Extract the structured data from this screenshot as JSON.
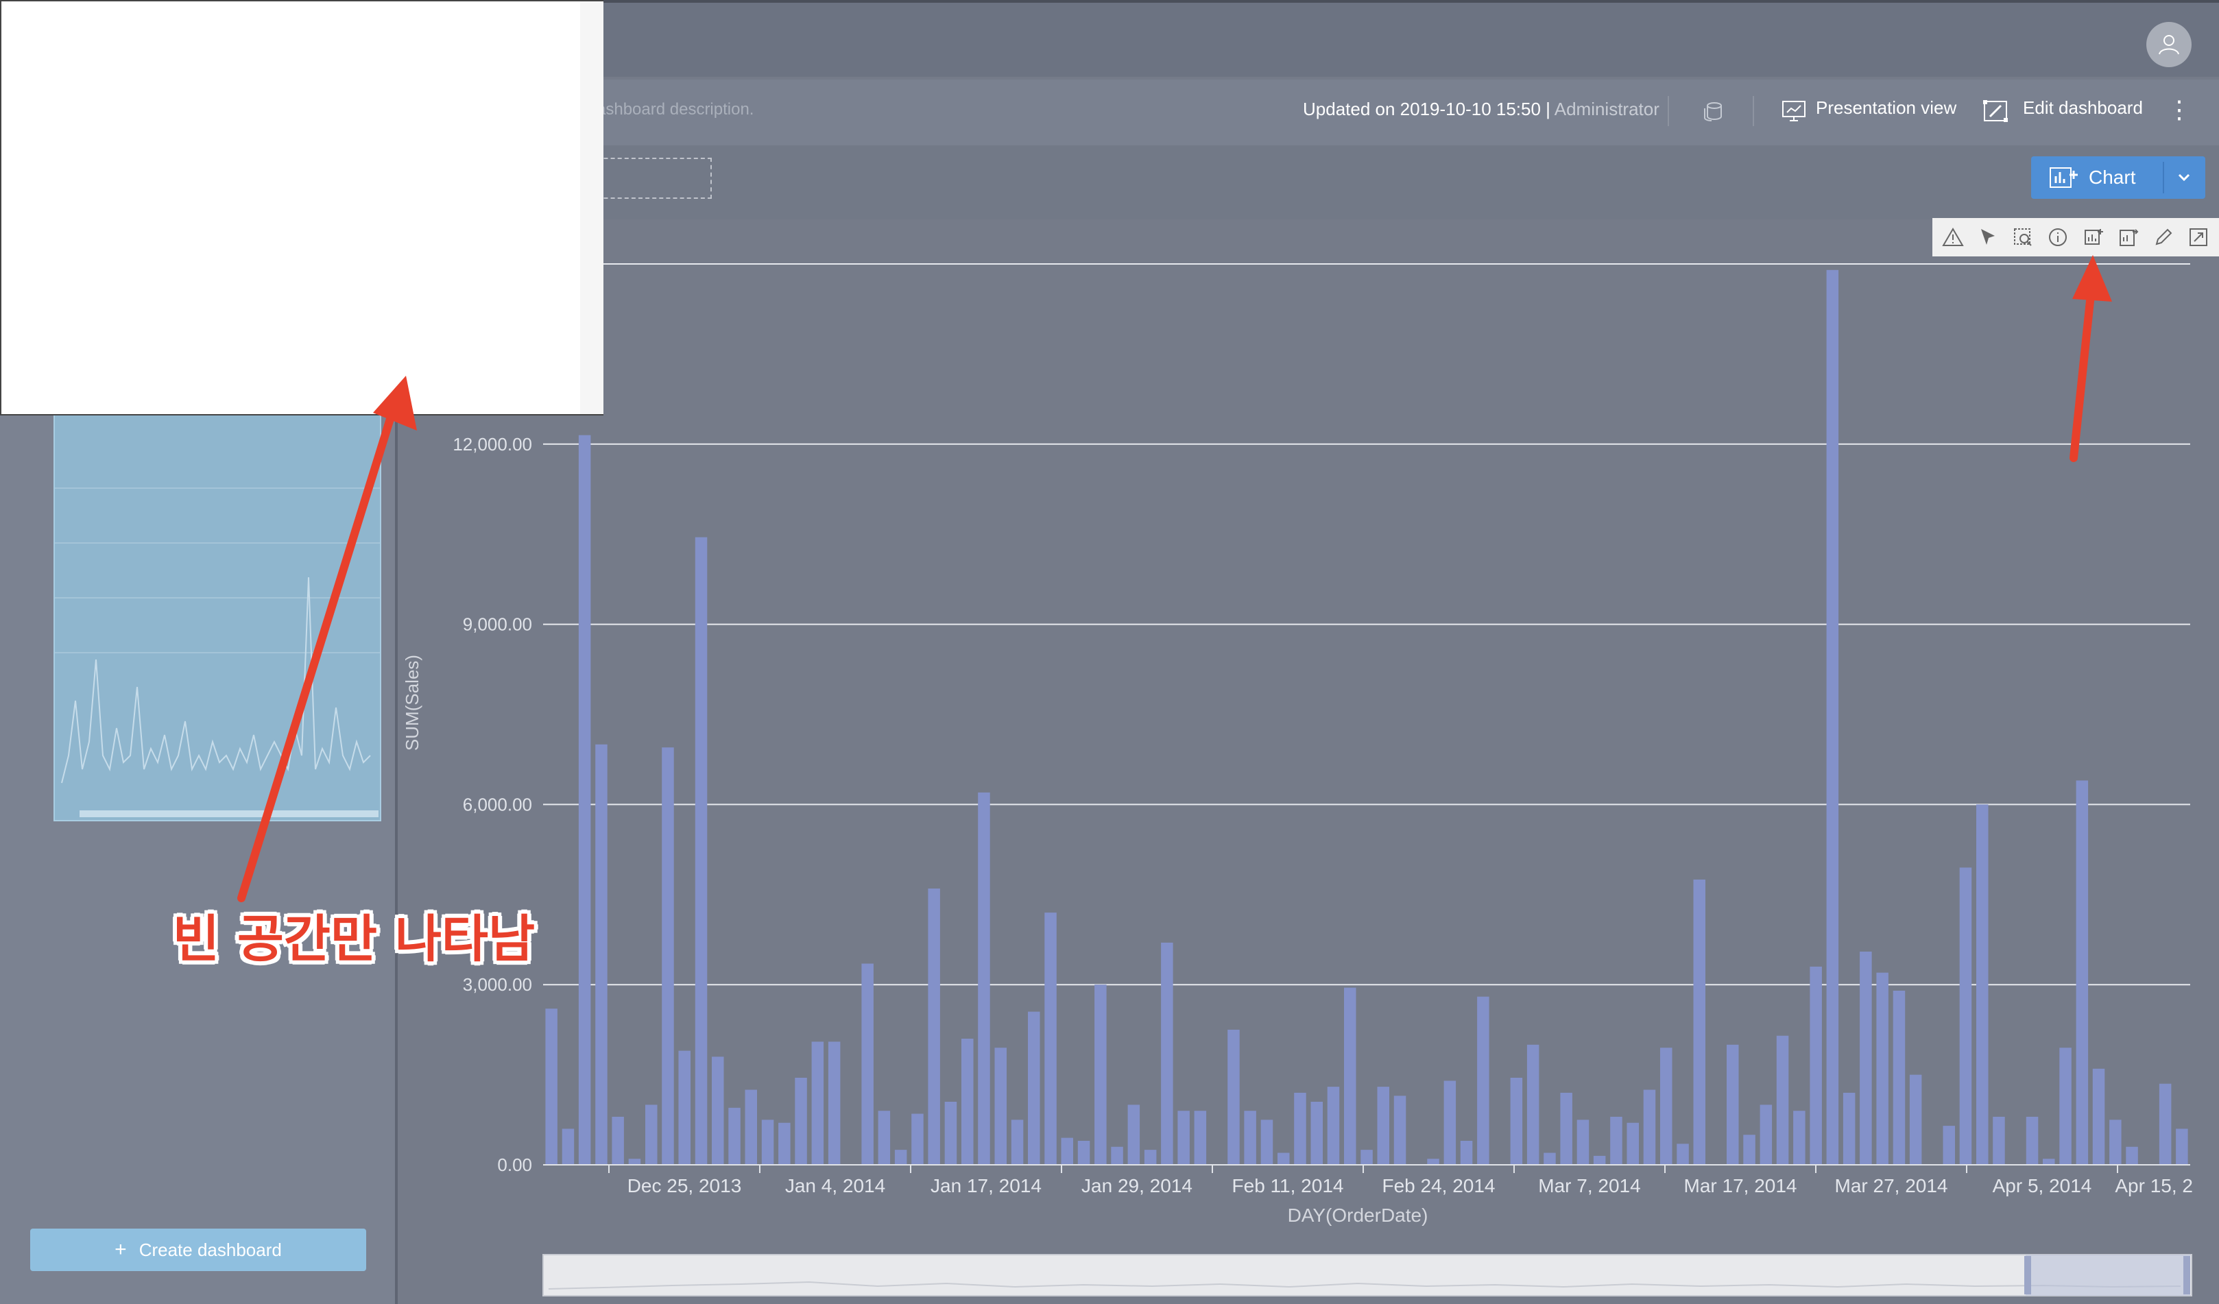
{
  "header": {
    "description_fragment": "ashboard description.",
    "updated": "Updated on 2019-10-10 15:50",
    "separator": " | ",
    "updated_by": "Administrator",
    "presentation_label": "Presentation view",
    "edit_label": "Edit dashboard",
    "more_label": "⋮"
  },
  "toolbar": {
    "chart_button_label": "Chart"
  },
  "sidebar": {
    "create_button_label": "Create dashboard",
    "create_button_glyph": "+"
  },
  "annotation": {
    "text": "빈 공간만 나타남"
  },
  "colors": {
    "bar": "#8391c9",
    "accent_blue": "#4f8fd6",
    "annotation": "#e8402b",
    "background": "#757b89"
  },
  "icons": {
    "chart_toolbar": [
      "warning-icon",
      "pointer-icon",
      "zoom-select-icon",
      "info-icon",
      "add-chart-icon",
      "export-icon",
      "edit-icon",
      "fullscreen-icon"
    ]
  },
  "chart_data": {
    "type": "bar",
    "xlabel": "DAY(OrderDate)",
    "ylabel": "SUM(Sales)",
    "ylim": [
      0,
      15000
    ],
    "yticks": [
      "0.00",
      "3,000.00",
      "6,000.00",
      "9,000.00",
      "12,000.00"
    ],
    "grid": true,
    "x_tick_labels": [
      "Dec 25, 2013",
      "Jan 4, 2014",
      "Jan 17, 2014",
      "Jan 29, 2014",
      "Feb 11, 2014",
      "Feb 24, 2014",
      "Mar 7, 2014",
      "Mar 17, 2014",
      "Mar 27, 2014",
      "Apr 5, 2014",
      "Apr 15, 2"
    ],
    "values": [
      2600,
      600,
      12150,
      7000,
      800,
      100,
      1000,
      6950,
      1900,
      10450,
      1800,
      950,
      1250,
      750,
      700,
      1450,
      2050,
      2050,
      0,
      3350,
      900,
      250,
      850,
      4600,
      1050,
      2100,
      6200,
      1950,
      750,
      2550,
      4200,
      450,
      400,
      3000,
      300,
      1000,
      250,
      3700,
      900,
      900,
      0,
      2250,
      900,
      750,
      200,
      1200,
      1050,
      1300,
      2950,
      250,
      1300,
      1150,
      0,
      100,
      1400,
      400,
      2800,
      0,
      1450,
      2000,
      200,
      1200,
      750,
      150,
      800,
      700,
      1250,
      1950,
      350,
      4750,
      0,
      2000,
      500,
      1000,
      2150,
      900,
      3300,
      14900,
      1200,
      3550,
      3200,
      2900,
      1500,
      0,
      650,
      4950,
      6000,
      800,
      0,
      800,
      100,
      1950,
      6400,
      1600,
      750,
      300,
      0,
      1350,
      600
    ]
  }
}
